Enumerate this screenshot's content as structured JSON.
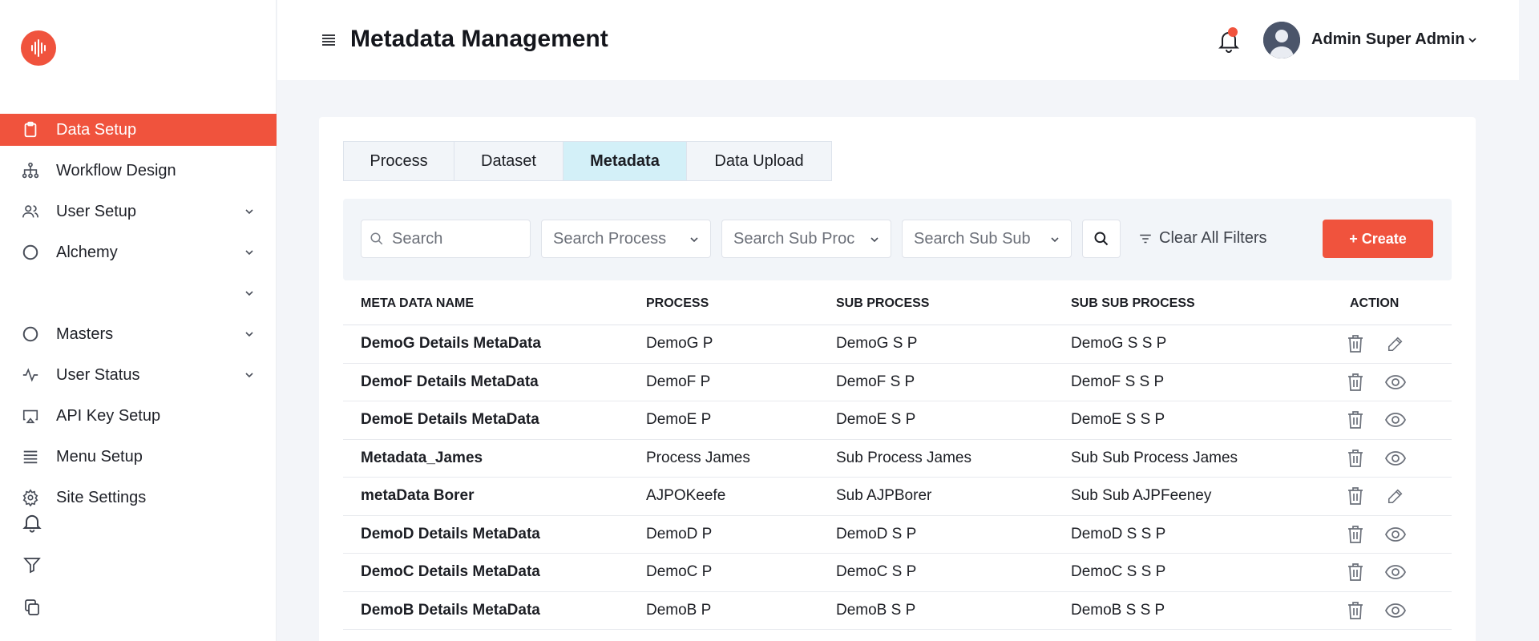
{
  "sidebar": {
    "items": [
      {
        "label": "Data Setup",
        "icon": "clipboard-icon",
        "active": true,
        "has_chevron": false
      },
      {
        "label": "Workflow Design",
        "icon": "hierarchy-icon",
        "active": false,
        "has_chevron": false
      },
      {
        "label": "User Setup",
        "icon": "users-icon",
        "active": false,
        "has_chevron": true
      },
      {
        "label": "Alchemy",
        "icon": "circle-icon",
        "active": false,
        "has_chevron": true
      },
      {
        "label": "",
        "icon": "",
        "active": false,
        "has_chevron": true
      },
      {
        "label": "Masters",
        "icon": "circle-icon",
        "active": false,
        "has_chevron": true
      },
      {
        "label": "User Status",
        "icon": "activity-icon",
        "active": false,
        "has_chevron": true
      },
      {
        "label": "API Key Setup",
        "icon": "cast-icon",
        "active": false,
        "has_chevron": false
      },
      {
        "label": "Menu Setup",
        "icon": "list-icon",
        "active": false,
        "has_chevron": false
      },
      {
        "label": "Site Settings",
        "icon": "gear-icon",
        "active": false,
        "has_chevron": false
      }
    ],
    "bottom_icons": [
      "bell-icon",
      "filter-icon",
      "copy-icon"
    ]
  },
  "header": {
    "title": "Metadata Management",
    "user_name": "Admin Super Admin"
  },
  "tabs": [
    {
      "label": "Process",
      "active": false
    },
    {
      "label": "Dataset",
      "active": false
    },
    {
      "label": "Metadata",
      "active": true
    },
    {
      "label": "Data Upload",
      "active": false
    }
  ],
  "filters": {
    "search_placeholder": "Search",
    "process_placeholder": "Search Process",
    "sub_process_placeholder": "Search Sub Proc",
    "sub_sub_process_placeholder": "Search Sub Sub",
    "clear_label": "Clear All Filters",
    "create_label": "+ Create"
  },
  "table": {
    "columns": [
      "META DATA NAME",
      "PROCESS",
      "SUB PROCESS",
      "SUB SUB PROCESS",
      "ACTION"
    ],
    "rows": [
      {
        "name": "DemoG Details MetaData",
        "process": "DemoG P",
        "sub_process": "DemoG S P",
        "sub_sub_process": "DemoG S S P",
        "second_action": "edit"
      },
      {
        "name": "DemoF Details MetaData",
        "process": "DemoF P",
        "sub_process": "DemoF S P",
        "sub_sub_process": "DemoF S S P",
        "second_action": "view"
      },
      {
        "name": "DemoE Details MetaData",
        "process": "DemoE P",
        "sub_process": "DemoE S P",
        "sub_sub_process": "DemoE S S P",
        "second_action": "view"
      },
      {
        "name": "Metadata_James",
        "process": "Process James",
        "sub_process": "Sub Process James",
        "sub_sub_process": "Sub Sub Process James",
        "second_action": "view"
      },
      {
        "name": "metaData Borer",
        "process": "AJPOKeefe",
        "sub_process": "Sub AJPBorer",
        "sub_sub_process": "Sub Sub AJPFeeney",
        "second_action": "edit"
      },
      {
        "name": "DemoD Details MetaData",
        "process": "DemoD P",
        "sub_process": "DemoD S P",
        "sub_sub_process": "DemoD S S P",
        "second_action": "view"
      },
      {
        "name": "DemoC Details MetaData",
        "process": "DemoC P",
        "sub_process": "DemoC S P",
        "sub_sub_process": "DemoC S S P",
        "second_action": "view"
      },
      {
        "name": "DemoB Details MetaData",
        "process": "DemoB P",
        "sub_process": "DemoB S P",
        "sub_sub_process": "DemoB S S P",
        "second_action": "view"
      }
    ]
  },
  "colors": {
    "accent": "#f0533d",
    "active_tab": "#d3f0f8"
  }
}
